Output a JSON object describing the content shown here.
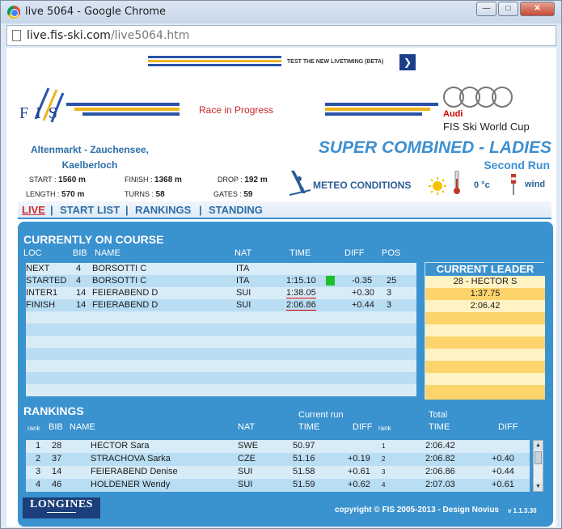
{
  "window": {
    "title": "live 5064 - Google Chrome",
    "min": "—",
    "max": "□",
    "close": "✕"
  },
  "address": {
    "host": "live.fis-ski.com",
    "path": "/live5064.htm"
  },
  "beta_banner": {
    "text": "TEST THE NEW LIVETIMING (BETA)",
    "arrow": "❯"
  },
  "header": {
    "fis_logo_text": "F I S",
    "race_status": "Race in Progress",
    "sponsor_name": "Audi",
    "sponsor_subtitle": "FIS Ski World Cup",
    "colors": {
      "blue": "#2a52a8",
      "gold": "#f0b41c"
    }
  },
  "venue": {
    "line1": "Altenmarkt - Zauchensee,",
    "line2": "Kaelberloch"
  },
  "event": {
    "title": "SUPER COMBINED - LADIES",
    "run": "Second Run"
  },
  "course_stats": {
    "start_label": "START :",
    "start_value": "1560 m",
    "finish_label": "FINISH :",
    "finish_value": "1368 m",
    "drop_label": "DROP :",
    "drop_value": "192 m",
    "length_label": "LENGTH :",
    "length_value": "570 m",
    "turns_label": "TURNS :",
    "turns_value": "58",
    "gates_label": "GATES :",
    "gates_value": "59"
  },
  "meteo": {
    "label": "METEO CONDITIONS",
    "temperature": "0 °c",
    "wind": "wind"
  },
  "nav": {
    "live": "LIVE",
    "start_list": "START LIST",
    "rankings": "RANKINGS",
    "standing": "STANDING",
    "sep": "|"
  },
  "on_course": {
    "title": "CURRENTLY ON COURSE",
    "headers": {
      "loc": "LOC",
      "bib": "BIB",
      "name": "NAME",
      "nat": "NAT",
      "time": "TIME",
      "diff": "DIFF",
      "pos": "POS"
    },
    "rows": [
      {
        "loc": "NEXT",
        "bib": "4",
        "name": "BORSOTTI C",
        "nat": "ITA",
        "time": "",
        "diff": "",
        "pos": ""
      },
      {
        "loc": "STARTED",
        "bib": "4",
        "name": "BORSOTTI C",
        "nat": "ITA",
        "time": "1:15.10",
        "diff": "-0.35",
        "pos": "25"
      },
      {
        "loc": "INTER1",
        "bib": "14",
        "name": "FEIERABEND D",
        "nat": "SUI",
        "time": "1:38.05",
        "diff": "+0.30",
        "pos": "3"
      },
      {
        "loc": "FINISH",
        "bib": "14",
        "name": "FEIERABEND D",
        "nat": "SUI",
        "time": "2:06.86",
        "diff": "+0.44",
        "pos": "3"
      }
    ]
  },
  "current_leader": {
    "title": "CURRENT LEADER",
    "name": "28 - HECTOR S",
    "time1": "1:37.75",
    "time2": "2:06.42"
  },
  "rankings": {
    "title": "RANKINGS",
    "headers": {
      "rank": "rank",
      "bib": "BIB",
      "name": "NAME",
      "nat": "NAT",
      "current_run": "Current run",
      "time": "TIME",
      "diff": "DIFF",
      "rank2": "rank",
      "total": "Total",
      "total_time": "TIME",
      "total_diff": "DIFF"
    },
    "rows": [
      {
        "rank": "1",
        "bib": "28",
        "name": "HECTOR Sara",
        "nat": "SWE",
        "time": "50.97",
        "diff": "",
        "rank2": "1",
        "total_time": "2:06.42",
        "total_diff": ""
      },
      {
        "rank": "2",
        "bib": "37",
        "name": "STRACHOVA Sarka",
        "nat": "CZE",
        "time": "51.16",
        "diff": "+0.19",
        "rank2": "2",
        "total_time": "2:06.82",
        "total_diff": "+0.40"
      },
      {
        "rank": "3",
        "bib": "14",
        "name": "FEIERABEND Denise",
        "nat": "SUI",
        "time": "51.58",
        "diff": "+0.61",
        "rank2": "3",
        "total_time": "2:06.86",
        "total_diff": "+0.44"
      },
      {
        "rank": "4",
        "bib": "46",
        "name": "HOLDENER Wendy",
        "nat": "SUI",
        "time": "51.59",
        "diff": "+0.62",
        "rank2": "4",
        "total_time": "2:07.03",
        "total_diff": "+0.61"
      }
    ]
  },
  "footer": {
    "longines": "LONGINES",
    "copyright": "copyright © FIS 2005-2013 - Design Novius",
    "version": "v 1.1.3.30"
  }
}
